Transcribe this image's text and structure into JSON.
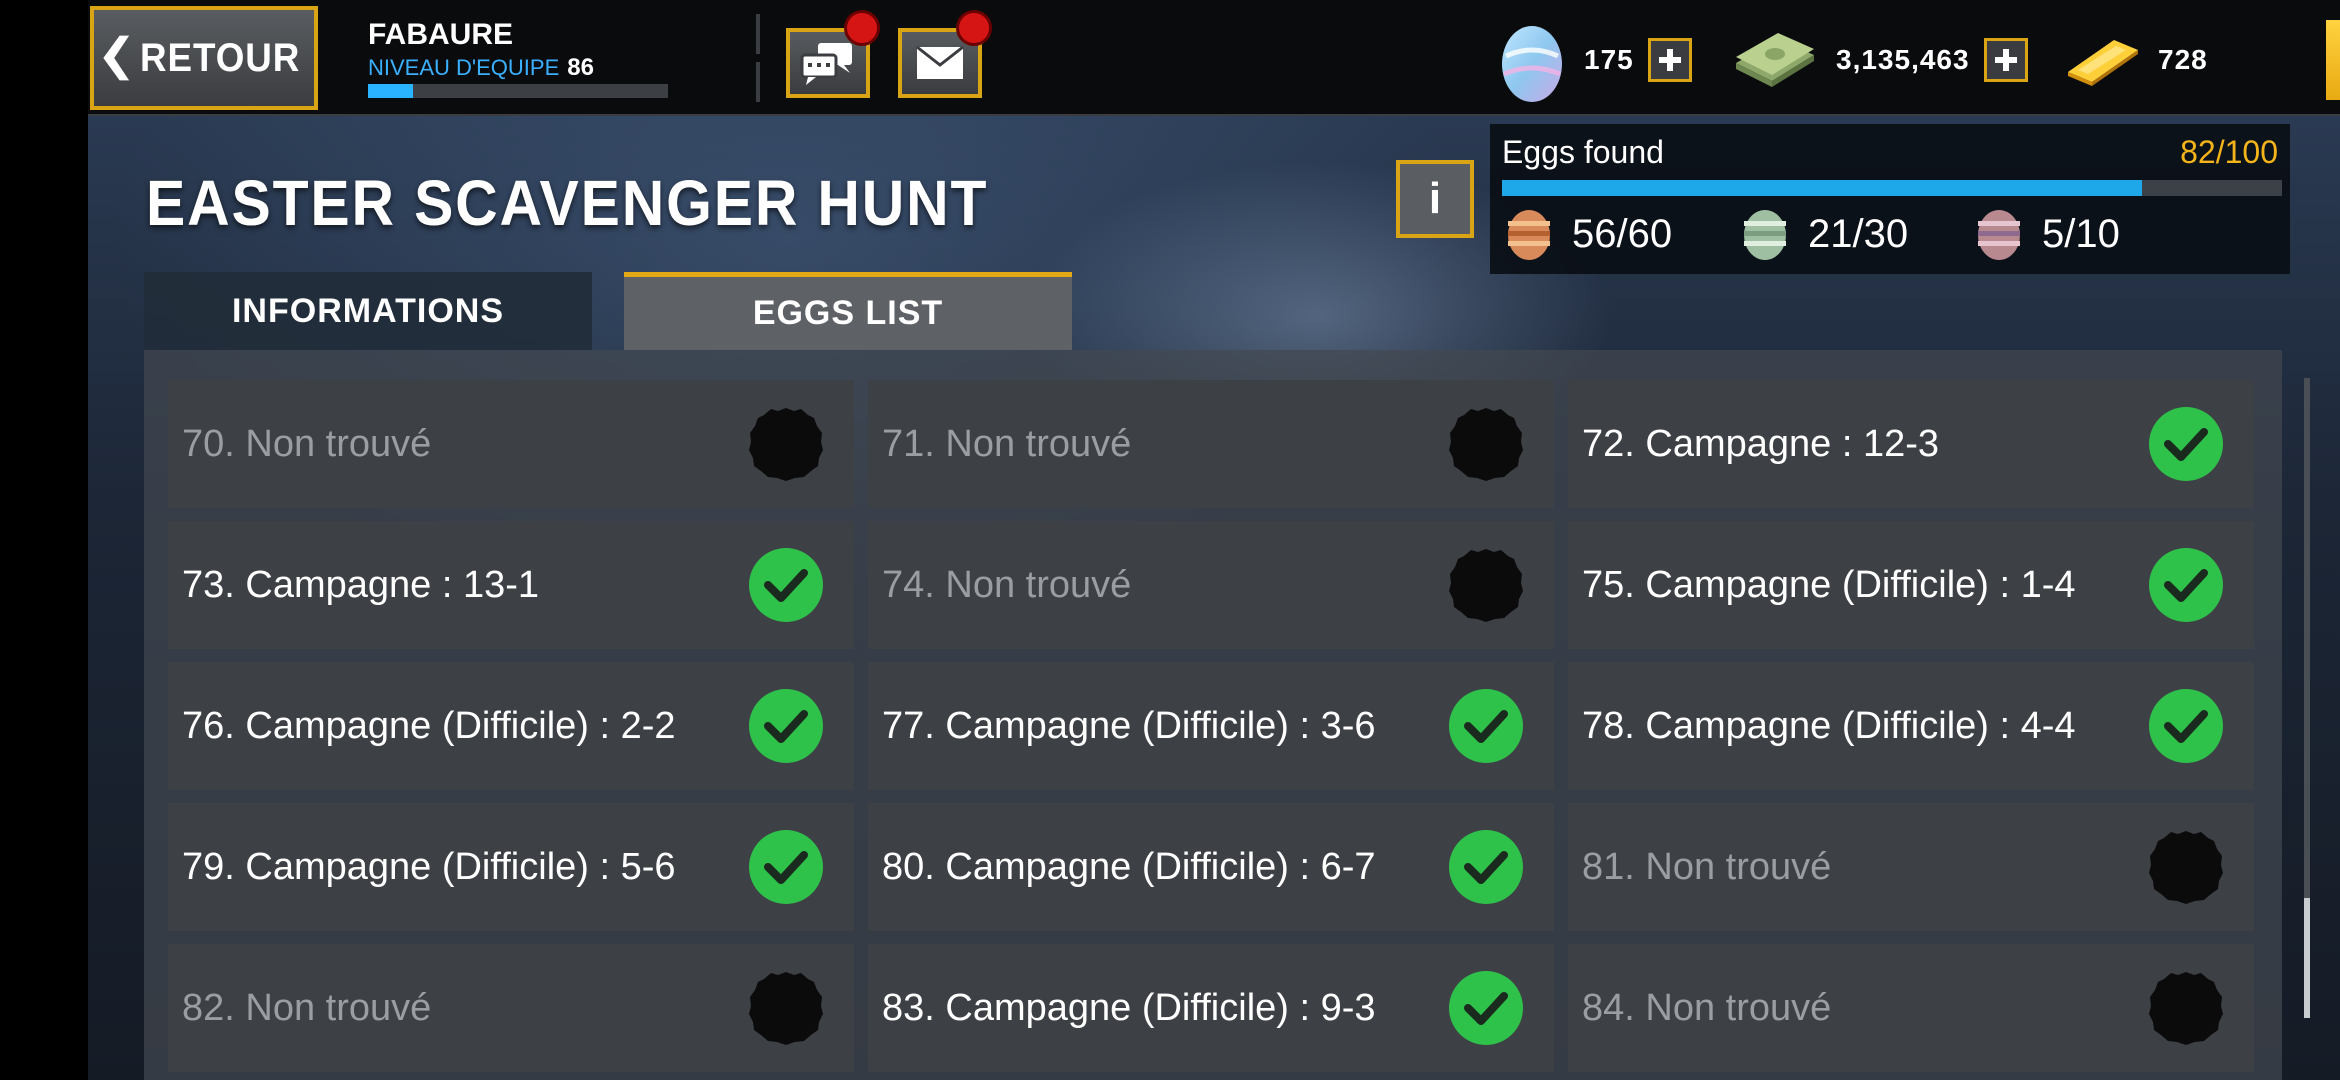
{
  "topbar": {
    "back_label": "RETOUR",
    "player_name": "FABAURE",
    "team_level_label": "NIVEAU D'EQUIPE",
    "team_level_value": "86",
    "xp_progress": 0.15,
    "eggs_currency": "175",
    "cash_currency": "3,135,463",
    "gold_currency": "728"
  },
  "event": {
    "title": "EASTER SCAVENGER HUNT",
    "info_icon_label": "i"
  },
  "eggs_found": {
    "label": "Eggs found",
    "count": "82/100",
    "progress": 0.82,
    "tiers": [
      {
        "name": "orange-egg",
        "value": "56/60"
      },
      {
        "name": "green-egg",
        "value": "21/30"
      },
      {
        "name": "purple-egg",
        "value": "5/10"
      }
    ]
  },
  "tabs": {
    "informations": "INFORMATIONS",
    "eggs_list": "EGGS LIST"
  },
  "eggs": [
    {
      "text": "70. Non trouvé",
      "found": false
    },
    {
      "text": "71. Non trouvé",
      "found": false
    },
    {
      "text": "72. Campagne : 12-3",
      "found": true
    },
    {
      "text": "73. Campagne : 13-1",
      "found": true
    },
    {
      "text": "74. Non trouvé",
      "found": false
    },
    {
      "text": "75. Campagne (Difficile) : 1-4",
      "found": true
    },
    {
      "text": "76. Campagne (Difficile) : 2-2",
      "found": true
    },
    {
      "text": "77. Campagne (Difficile) : 3-6",
      "found": true
    },
    {
      "text": "78. Campagne (Difficile) : 4-4",
      "found": true
    },
    {
      "text": "79. Campagne (Difficile) : 5-6",
      "found": true
    },
    {
      "text": "80. Campagne (Difficile) : 6-7",
      "found": true
    },
    {
      "text": "81. Non trouvé",
      "found": false
    },
    {
      "text": "82. Non trouvé",
      "found": false
    },
    {
      "text": "83. Campagne (Difficile) : 9-3",
      "found": true
    },
    {
      "text": "84. Non trouvé",
      "found": false
    }
  ],
  "colors": {
    "accent": "#d9a514",
    "found_check": "#2fc24a",
    "progress": "#1ea8ea",
    "count_gold": "#f4b41a"
  }
}
